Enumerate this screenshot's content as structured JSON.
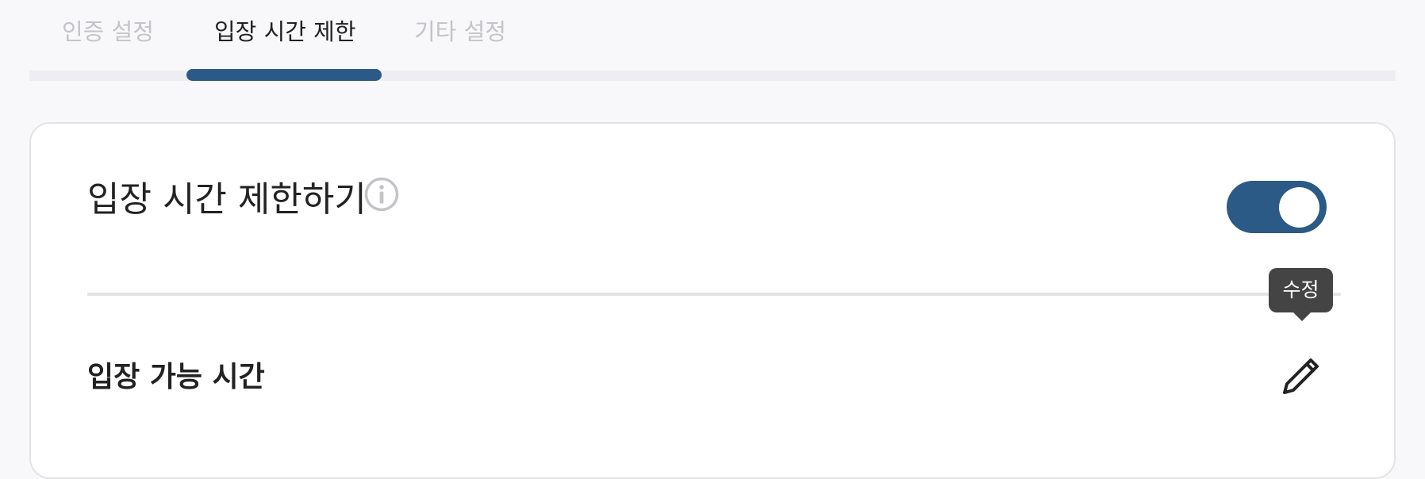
{
  "tabs": [
    {
      "label": "인증 설정",
      "active": false
    },
    {
      "label": "입장 시간 제한",
      "active": true
    },
    {
      "label": "기타 설정",
      "active": false
    }
  ],
  "colors": {
    "accent": "#2b5a86",
    "inactive_tab": "#c4c4c8",
    "tooltip_bg": "#444444"
  },
  "section": {
    "title": "입장 시간 제한하기",
    "info_icon": "info-circle-icon",
    "toggle_on": true
  },
  "row": {
    "label": "입장 가능 시간",
    "edit_icon": "pencil-icon",
    "tooltip": "수정"
  }
}
